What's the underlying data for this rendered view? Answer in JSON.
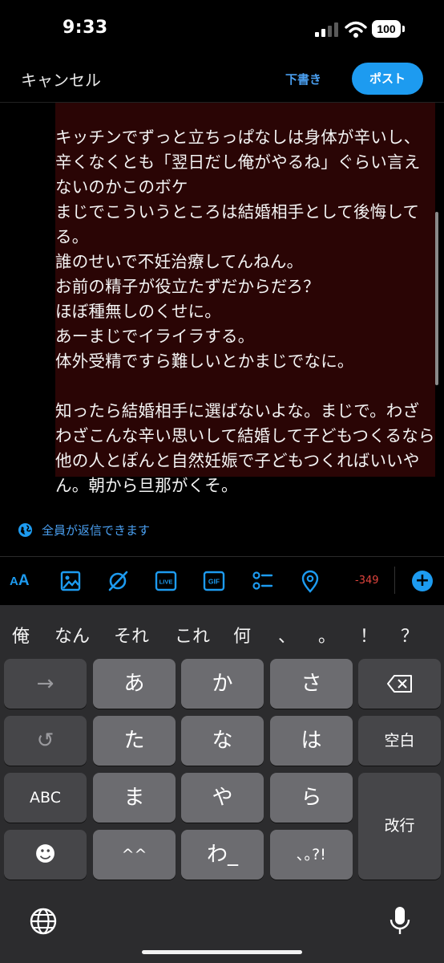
{
  "status_bar": {
    "time": "9:33",
    "battery": "100"
  },
  "header": {
    "cancel": "キャンセル",
    "draft": "下書き",
    "post": "ポスト"
  },
  "composer": {
    "text": "キッチンでずっと立ちっぱなしは身体が辛いし、辛くなくとも「翌日だし俺がやるね」ぐらい言えないのかこのボケ\nまじでこういうところは結婚相手として後悔してる。\n誰のせいで不妊治療してんねん。\nお前の精子が役立たずだからだろ？\nほぼ種無しのくせに。\nあーまじでイライラする。\n体外受精ですら難しいとかまじでなに。\n\n知ったら結婚相手に選ばないよな。まじで。わざわざこんな辛い思いして結婚して子どもつくるなら他の人とぽんと自然妊娠で子どもつくればいいやん。朝から旦那がくそ。",
    "highlight_color": "#2a0505"
  },
  "reply_setting": {
    "label": "全員が返信できます",
    "icon": "globe-icon"
  },
  "toolbar": {
    "text_format_label": "AA",
    "live_label": "LIVE",
    "gif_label": "GIF",
    "char_counter": "-349",
    "icons": [
      "text-format-icon",
      "image-icon",
      "grok-icon",
      "live-icon",
      "gif-icon",
      "poll-icon",
      "location-icon",
      "add-icon"
    ],
    "accent": "#1d9bf0"
  },
  "keyboard": {
    "candidates": [
      "俺",
      "なん",
      "それ",
      "これ",
      "何",
      "、",
      "。",
      "！",
      "？"
    ],
    "keys": {
      "next": "→",
      "a": "あ",
      "ka": "か",
      "sa": "さ",
      "undo": "↺",
      "ta": "た",
      "na": "な",
      "ha": "は",
      "space": "空白",
      "abc": "ABC",
      "ma": "ま",
      "ya": "や",
      "ra": "ら",
      "enter": "改行",
      "emoji": "☻",
      "dakuten": "^^",
      "wa": "わ_",
      "punct": "､｡?!"
    }
  }
}
